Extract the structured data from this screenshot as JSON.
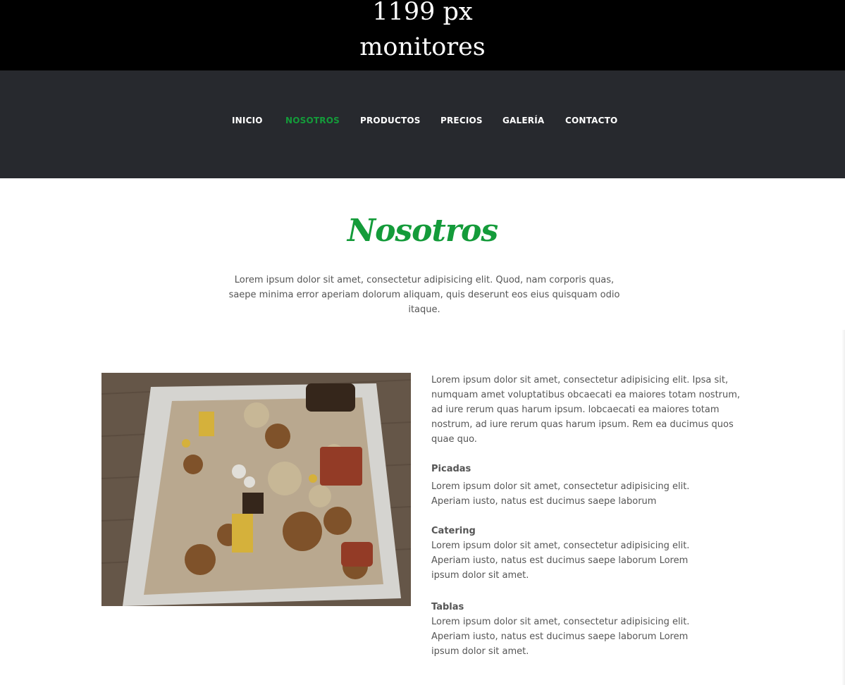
{
  "banner": {
    "line1": "1199 px",
    "line2": "monitores"
  },
  "nav": {
    "items": [
      {
        "label": "INICIO"
      },
      {
        "label": "NOSOTROS"
      },
      {
        "label": "PRODUCTOS"
      },
      {
        "label": "PRECIOS"
      },
      {
        "label": "GALERÍA"
      },
      {
        "label": "CONTACTO"
      }
    ],
    "active_color": "#149b3a",
    "background": "#27292e"
  },
  "about": {
    "title": "Nosotros",
    "intro": "Lorem ipsum dolor sit amet, consectetur adipisicing elit. Quod, nam corporis quas, saepe minima error aperiam dolorum aliquam, quis deserunt eos eius quisquam odio itaque.",
    "main_text": "Lorem ipsum dolor sit amet, consectetur adipisicing elit. Ipsa sit, numquam amet voluptatibus obcaecati ea maiores totam nostrum, ad iure rerum quas harum ipsum. lobcaecati ea maiores totam nostrum, ad iure rerum quas harum ipsum. Rem ea ducimus quos quae quo.",
    "services": [
      {
        "title": "Picadas",
        "text": "Lorem ipsum dolor sit amet, consectetur adipisicing elit. Aperiam iusto, natus est ducimus saepe laborum"
      },
      {
        "title": "Catering",
        "text": "Lorem ipsum dolor sit amet, consectetur adipisicing elit. Aperiam iusto, natus est ducimus saepe laborum Lorem ipsum dolor sit amet."
      },
      {
        "title": "Tablas",
        "text": "Lorem ipsum dolor sit amet, consectetur adipisicing elit. Aperiam iusto, natus est ducimus saepe laborum Lorem ipsum dolor sit amet."
      }
    ]
  }
}
